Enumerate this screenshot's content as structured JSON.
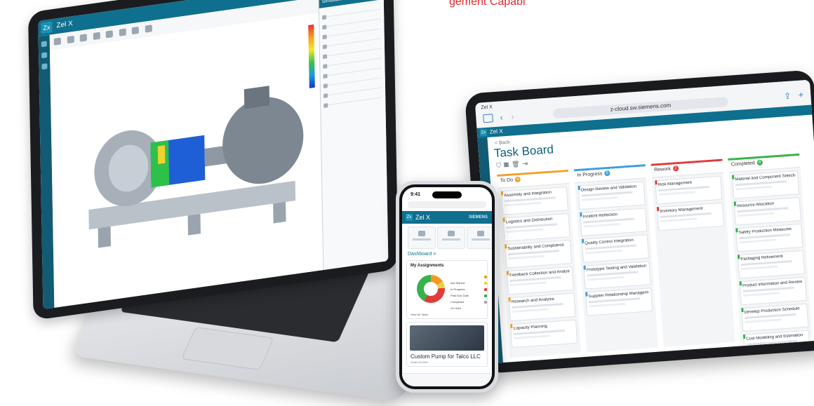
{
  "caption": "gement Capabi",
  "laptop": {
    "app_name": "Zel X",
    "tab_label": "Simulation",
    "panel_title": "Simulation Navigator"
  },
  "tablet": {
    "safari": {
      "tab_label": "Zel X",
      "aa": "AA",
      "url": "z-cloud.sw.siemens.com"
    },
    "app_name": "Zel X",
    "breadcrumb": "< Back",
    "title": "Task Board",
    "columns": [
      {
        "name": "To Do",
        "count": "6",
        "accent": "#f3a12a",
        "cards": [
          "Assembly and Integration",
          "Logistics and Distribution",
          "Sustainability and Compliance",
          "Feedback Collection and Analysis",
          "Research and Analysis",
          "Capacity Planning"
        ]
      },
      {
        "name": "In Progress",
        "count": "5",
        "accent": "#3aa0e0",
        "cards": [
          "Design Review and Validation",
          "Incident Reflection",
          "Quality Control Integration",
          "Prototype Testing and Validation",
          "Supplier Relationship Management"
        ]
      },
      {
        "name": "Rework",
        "count": "2",
        "accent": "#e23b3b",
        "cards": [
          "Risk Management",
          "Inventory Management"
        ]
      },
      {
        "name": "Completed",
        "count": "8",
        "accent": "#36b24a",
        "cards": [
          "Material and Component Selection",
          "Resource Allocation",
          "Safety Production Measures",
          "Packaging Refinement",
          "Product Information and Review",
          "Develop Production Schedule",
          "Cost Modelling and Estimation"
        ]
      }
    ]
  },
  "phone": {
    "time": "9:41",
    "app_name": "Zel X",
    "brand": "SIEMENS",
    "quick_actions": [
      "Create Project",
      "Capacity Planning",
      "Requests"
    ],
    "dashboard_link": "Dashboard >",
    "assignments_title": "My Assignments",
    "legend": [
      {
        "label": "Not Started",
        "color": "#f39a1c"
      },
      {
        "label": "In Progress",
        "color": "#e9d24a"
      },
      {
        "label": "Past Due Date",
        "color": "#e23b3b"
      },
      {
        "label": "Completed",
        "color": "#36b24a"
      },
      {
        "label": "On Hold",
        "color": "#9aa6b2"
      }
    ],
    "view_all": "View All Tasks",
    "product_title": "Custom Pump for Talco LLC",
    "product_sub": "Order #12345"
  },
  "colors": {
    "brand_primary": "#0f6f8e",
    "brand_dark": "#125b74"
  }
}
